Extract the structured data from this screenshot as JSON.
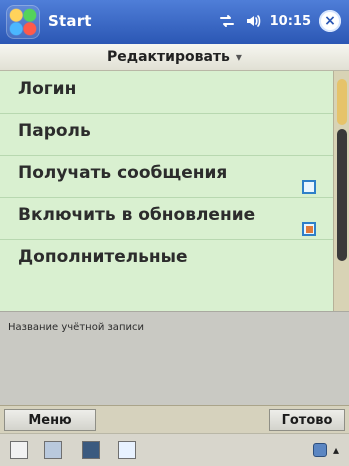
{
  "titlebar": {
    "title": "Start",
    "time": "10:15",
    "close_label": "×",
    "icons": {
      "start": "windows-start-icon",
      "connectivity": "connectivity-arrows-icon",
      "volume": "speaker-icon",
      "close": "close-icon"
    }
  },
  "header": {
    "dropdown_label": "Редактировать",
    "dropdown_chevron": "▾"
  },
  "list": {
    "items": [
      {
        "label": "Логин"
      },
      {
        "label": "Пароль"
      },
      {
        "label": "Получать сообщения"
      },
      {
        "label": "Включить в обновление"
      },
      {
        "label": "Дополнительные"
      }
    ],
    "checkbox_states": {
      "get_messages": false,
      "include_in_update": true
    }
  },
  "info": {
    "account_name_label": "Название учётной записи"
  },
  "softkeys": {
    "left": "Меню",
    "right": "Готово"
  },
  "taskbar": {
    "icons": [
      "accessibility-icon",
      "image-icon",
      "photo-icon",
      "window-icon",
      "keyboard-icon"
    ]
  }
}
